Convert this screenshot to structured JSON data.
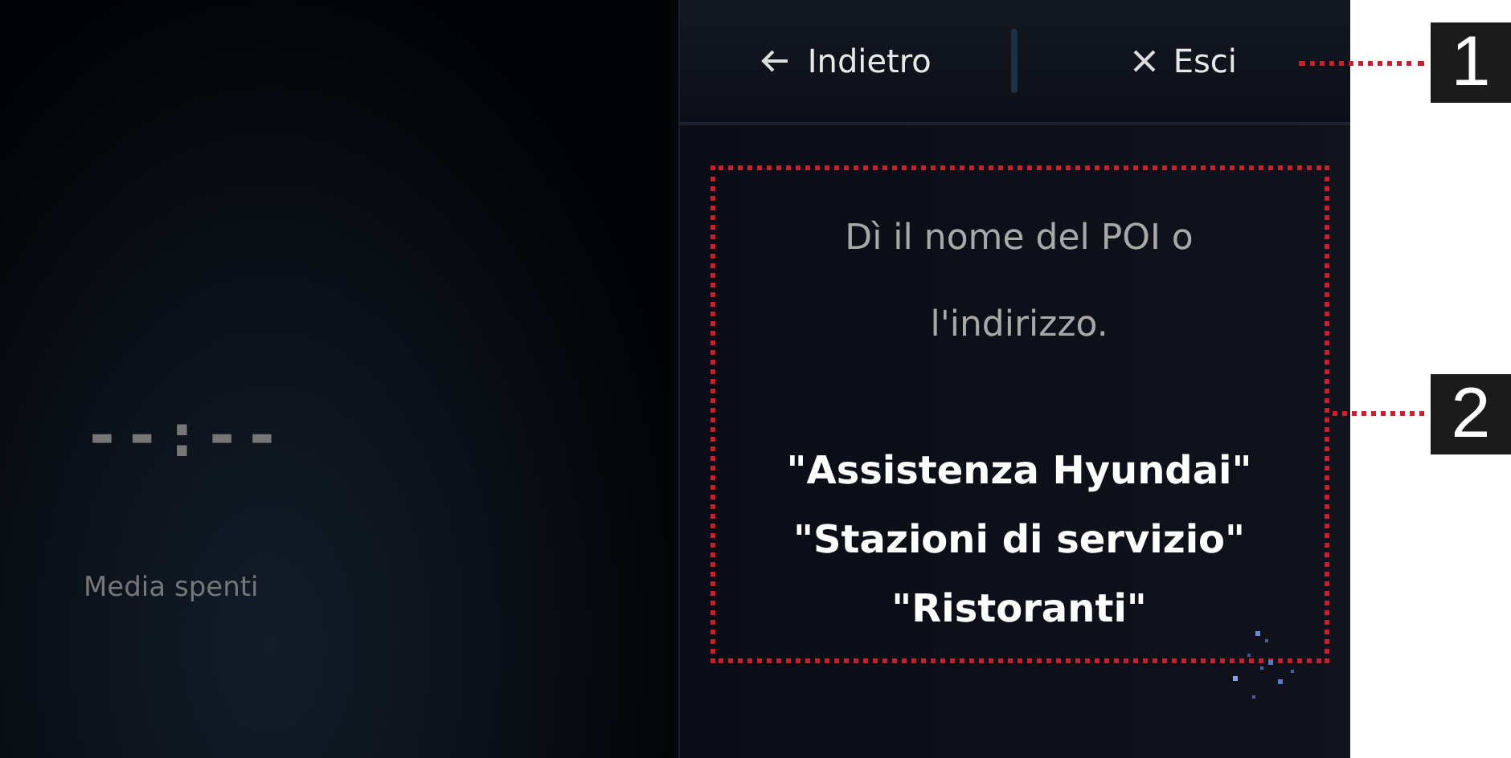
{
  "media": {
    "clock": "--:--",
    "status": "Media spenti"
  },
  "header": {
    "buttons": [
      {
        "kind": "back",
        "label": "Indietro"
      },
      {
        "kind": "exit",
        "label": "Esci"
      }
    ]
  },
  "prompt": {
    "instruction": "Dì il nome del POI o l'indirizzo.",
    "examples": [
      "\"Assistenza Hyundai\"",
      "\"Stazioni di servizio\"",
      "\"Ristoranti\""
    ]
  },
  "callouts": [
    {
      "label": "1"
    },
    {
      "label": "2"
    }
  ]
}
